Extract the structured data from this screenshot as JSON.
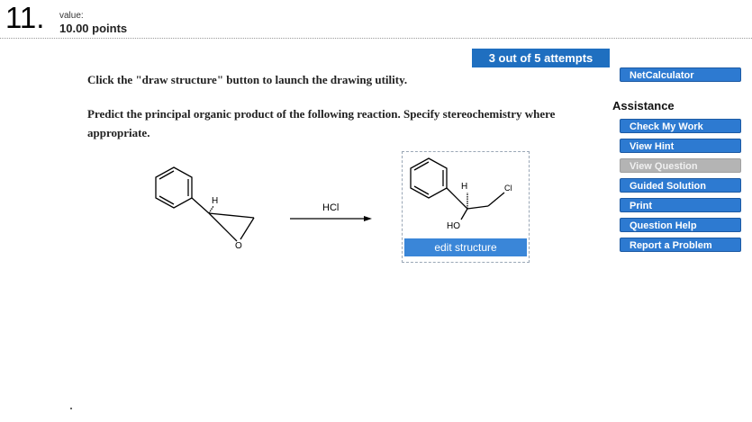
{
  "question": {
    "number": "11.",
    "value_label": "value:",
    "points": "10.00 points",
    "attempts": "3 out of 5 attempts",
    "instruction": "Click the \"draw structure\" button to launch the drawing utility.",
    "prompt": "Predict the principal organic product of the following reaction. Specify stereochemistry where appropriate."
  },
  "reaction": {
    "reactant_labels": {
      "h": "H",
      "o": "O"
    },
    "reagent": "HCl",
    "product_labels": {
      "h": "H",
      "ho": "HO",
      "cl": "Cl"
    }
  },
  "answer": {
    "edit_button": "edit structure"
  },
  "sidebar": {
    "netcalculator": "NetCalculator",
    "assistance_title": "Assistance",
    "buttons": [
      {
        "label": "Check My Work",
        "enabled": true
      },
      {
        "label": "View Hint",
        "enabled": true
      },
      {
        "label": "View Question",
        "enabled": false
      },
      {
        "label": "Guided Solution",
        "enabled": true
      },
      {
        "label": "Print",
        "enabled": true
      },
      {
        "label": "Question Help",
        "enabled": true
      },
      {
        "label": "Report a Problem",
        "enabled": true
      }
    ]
  },
  "colors": {
    "primary_button": "#1f6fc0",
    "side_button": "#2d7ad1",
    "disabled_button": "#b4b4b4"
  }
}
